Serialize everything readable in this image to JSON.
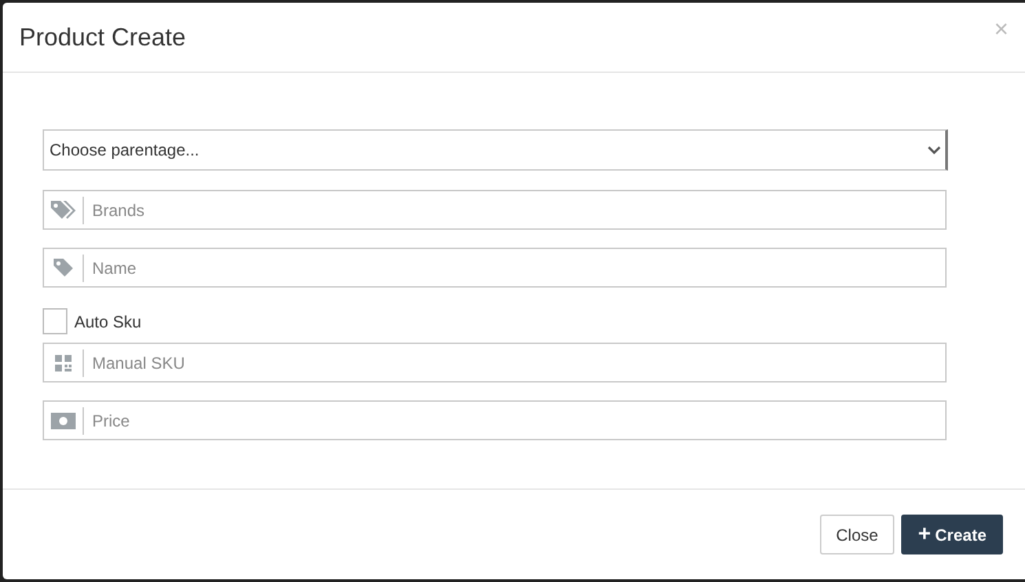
{
  "modal": {
    "title": "Product Create",
    "close_symbol": "×"
  },
  "parent_select": {
    "placeholder": "Choose parentage..."
  },
  "fields_top": [
    {
      "kind": "tags",
      "placeholder": "Brands"
    },
    {
      "kind": "tag",
      "placeholder": "Name"
    }
  ],
  "auto_sku": {
    "label": "Auto Sku",
    "checked": false
  },
  "fields_bottom": [
    {
      "kind": "qr",
      "placeholder": "Manual SKU"
    },
    {
      "kind": "money",
      "placeholder": "Price"
    }
  ],
  "buttons": [
    {
      "kind": "secondary",
      "label": "Close"
    },
    {
      "kind": "primary",
      "label": "Create",
      "icon": "+"
    }
  ]
}
